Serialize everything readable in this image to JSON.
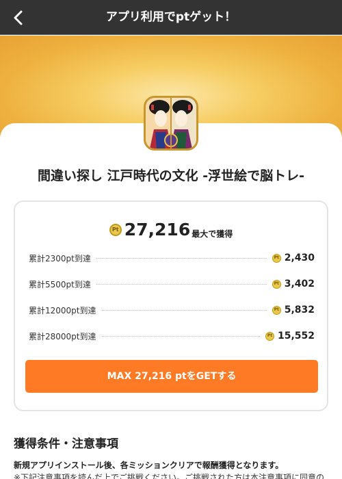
{
  "header": {
    "title": "アプリ利用でptゲット！",
    "back_icon": "chevron-left-icon"
  },
  "app": {
    "title": "間違い探し 江戸時代の文化 -浮世絵で脳トレ-",
    "icon": "ukiyoe-app-icon"
  },
  "reward": {
    "coin_label": "Pt",
    "total": "27,216",
    "total_suffix": "最大で獲得",
    "milestones": [
      {
        "label": "累計2300pt到達",
        "points": "2,430"
      },
      {
        "label": "累計5500pt到達",
        "points": "3,402"
      },
      {
        "label": "累計12000pt到達",
        "points": "5,832"
      },
      {
        "label": "累計28000pt到達",
        "points": "15,552"
      }
    ],
    "cta_label": "MAX 27,216 ptをGETする"
  },
  "conditions": {
    "title": "獲得条件・注意事項",
    "notice": "新規アプリインストール後、各ミッションクリアで報酬獲得となります。",
    "note": "※下記注意事項を読んだ上でご挑戦ください。ご挑戦された方は本注意事項に同意の"
  },
  "colors": {
    "header_bg": "#333333",
    "cta_bg": "#ff7a24",
    "hero_gold": "#eeb13f",
    "coin": "#e9c94a"
  }
}
